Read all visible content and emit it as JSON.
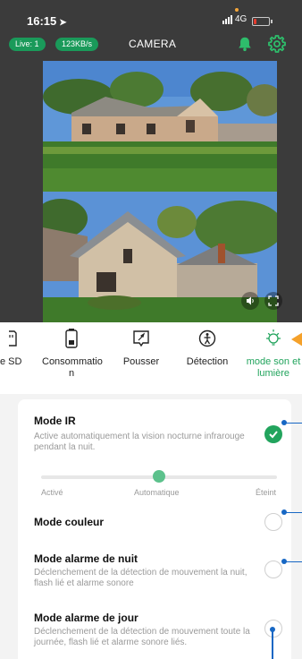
{
  "status": {
    "time": "16:15",
    "network": "4G",
    "battery_level": 0.15
  },
  "header": {
    "live_label": "Live: 1",
    "rate_label": "123KB/s",
    "title": "CAMERA"
  },
  "features": [
    {
      "label": "e SD",
      "icon": "sd-card-icon"
    },
    {
      "label": "Consommatio n",
      "icon": "battery-icon"
    },
    {
      "label": "Pousser",
      "icon": "push-notification-icon"
    },
    {
      "label": "Détection",
      "icon": "motion-detection-icon"
    },
    {
      "label": "mode son et lumière",
      "icon": "light-bulb-icon",
      "active": true
    }
  ],
  "settings": {
    "ir": {
      "title": "Mode IR",
      "desc": "Active automatiquement la vision nocturne infrarouge pendant la nuit.",
      "checked": true,
      "slider": {
        "labels": [
          "Activé",
          "Automatique",
          "Éteint"
        ],
        "value": "Automatique",
        "position": 0.5
      }
    },
    "color": {
      "title": "Mode couleur",
      "checked": false
    },
    "night_alarm": {
      "title": "Mode alarme de nuit",
      "desc": "Déclenchement de la détection de mouvement la nuit, flash lié et alarme sonore",
      "checked": false
    },
    "day_alarm": {
      "title": "Mode alarme de jour",
      "desc": "Déclenchement de la détection de mouvement toute la journée, flash lié et alarme sonore liés.",
      "checked": false
    }
  },
  "colors": {
    "accent_green": "#22a45d",
    "annotation_blue": "#1767c4",
    "arrow_orange": "#f5a12a"
  }
}
